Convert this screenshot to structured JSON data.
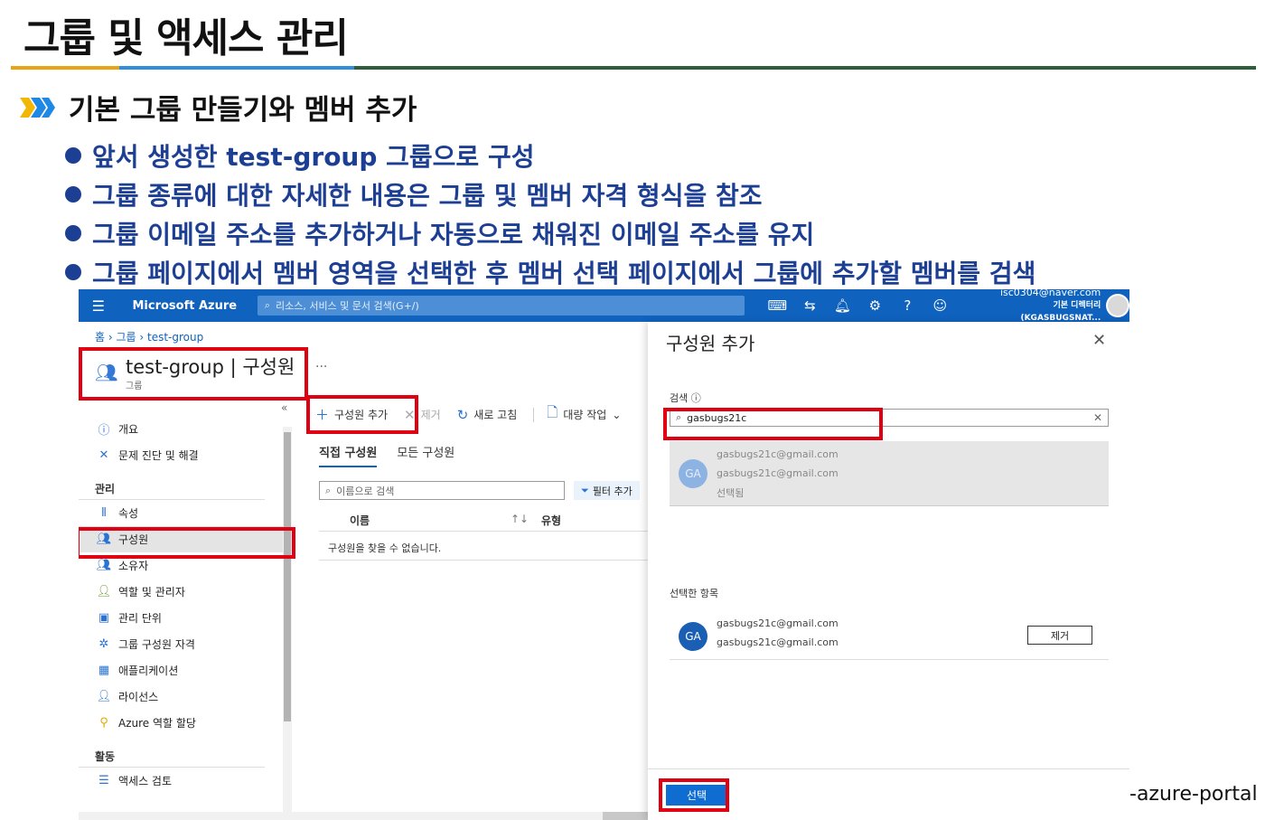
{
  "slide": {
    "title": "그룹 및 액세스 관리",
    "subheading": "기본 그룹 만들기와 멤버 추가",
    "bullets": [
      "앞서 생성한 test-group 그룹으로 구성",
      "그룹 종류에 대한 자세한 내용은 그룹 및 멤버 자격 형식을 참조",
      "그룹 이메일 주소를 추가하거나 자동으로 채워진 이메일 주소를 유지",
      "그룹 페이지에서 멤버 영역을 선택한 후 멤버 선택 페이지에서 그룹에 추가할 멤버를 검색"
    ],
    "caption": "-azure-portal",
    "highlight_color": "#e00012",
    "bullet_color": "#1c3f94"
  },
  "portal": {
    "brand": "Microsoft Azure",
    "search_placeholder": "리소스, 서비스 및 문서 검색(G+/)",
    "top_icons": [
      "terminal-icon",
      "directory-icon",
      "bell-icon",
      "gear-icon",
      "help-icon",
      "feedback-icon"
    ],
    "account": {
      "email": "isc0304@naver.com",
      "directory": "기본 디렉터리(KGASBUGSNAT..."
    },
    "breadcrumb": [
      "홈",
      "그룹",
      "test-group"
    ],
    "page_title": "test-group | 구성원",
    "page_subtitle": "그룹",
    "more": "...",
    "collapse": "«",
    "nav": {
      "top_items": [
        {
          "label": "개요",
          "icon": "info-icon"
        },
        {
          "label": "문제 진단 및 해결",
          "icon": "wrench-icon"
        }
      ],
      "sections": [
        {
          "title": "관리",
          "items": [
            {
              "label": "속성",
              "icon": "properties-icon"
            },
            {
              "label": "구성원",
              "icon": "members-icon"
            },
            {
              "label": "소유자",
              "icon": "owners-icon"
            },
            {
              "label": "역할 및 관리자",
              "icon": "roles-icon"
            },
            {
              "label": "관리 단위",
              "icon": "admin-unit-icon"
            },
            {
              "label": "그룹 구성원 자격",
              "icon": "membership-icon"
            },
            {
              "label": "애플리케이션",
              "icon": "apps-icon"
            },
            {
              "label": "라이선스",
              "icon": "license-icon"
            },
            {
              "label": "Azure 역할 할당",
              "icon": "key-icon"
            }
          ]
        },
        {
          "title": "활동",
          "items": [
            {
              "label": "액세스 검토",
              "icon": "access-review-icon"
            }
          ]
        }
      ]
    },
    "toolbar": {
      "add_member": "구성원 추가",
      "remove": "제거",
      "refresh": "새로 고침",
      "bulk": "대량 작업"
    },
    "tabs": [
      "직접 구성원",
      "모든 구성원"
    ],
    "member_search_placeholder": "이름으로 검색",
    "filter_label": "필터 추가",
    "table": {
      "col_name": "이름",
      "sort": "↑↓",
      "col_type": "유형",
      "empty": "구성원을 찾을 수 없습니다."
    }
  },
  "panel": {
    "title": "구성원 추가",
    "search_label": "검색",
    "search_value": "gasbugs21c",
    "result": {
      "initials": "GA",
      "line1": "gasbugs21c@gmail.com",
      "line2": "gasbugs21c@gmail.com",
      "line3": "선택됨"
    },
    "selected_label": "선택한 항목",
    "selected": {
      "initials": "GA",
      "line1": "gasbugs21c@gmail.com",
      "line2": "gasbugs21c@gmail.com"
    },
    "remove_button": "제거",
    "select_button": "선택"
  }
}
